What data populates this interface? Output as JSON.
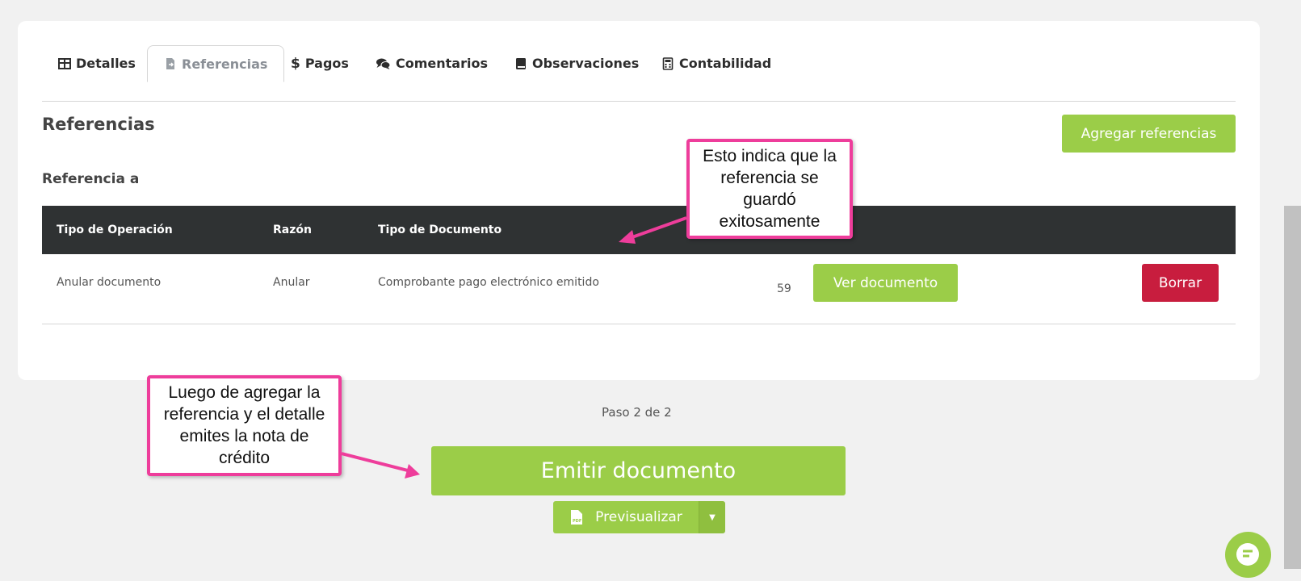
{
  "tabs": [
    {
      "label": "Detalles",
      "icon": "table-icon"
    },
    {
      "label": "Referencias",
      "icon": "file-export-icon",
      "active": true
    },
    {
      "label": "Pagos",
      "icon": "dollar-icon"
    },
    {
      "label": "Comentarios",
      "icon": "comments-icon"
    },
    {
      "label": "Observaciones",
      "icon": "book-icon"
    },
    {
      "label": "Contabilidad",
      "icon": "calculator-icon"
    }
  ],
  "section": {
    "title": "Referencias",
    "add_button": "Agregar referencias",
    "subtitle": "Referencia a"
  },
  "table": {
    "headers": [
      "Tipo de Operación",
      "Razón",
      "Tipo de Documento"
    ],
    "rows": [
      {
        "operation": "Anular documento",
        "reason": "Anular",
        "doc_type": "Comprobante pago electrónico emitido",
        "number": "59",
        "view_button": "Ver documento",
        "delete_button": "Borrar"
      }
    ]
  },
  "footer": {
    "step": "Paso 2 de 2",
    "emit_button": "Emitir documento",
    "preview_button": "Previsualizar"
  },
  "annotations": [
    {
      "text": "Esto indica que la referencia se guardó exitosamente"
    },
    {
      "text": "Luego de agregar la referencia y el detalle emites la nota de crédito"
    }
  ],
  "colors": {
    "accent_green": "#9bcd48",
    "danger_red": "#c81d3e",
    "table_header": "#2f3233",
    "callout_border": "#ee3d9b"
  }
}
